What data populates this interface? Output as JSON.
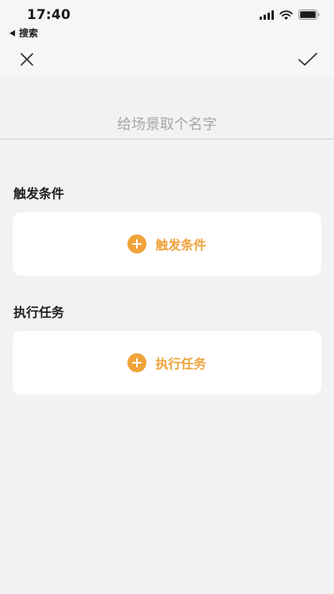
{
  "status_bar": {
    "time": "17:40",
    "back_label": "搜索"
  },
  "nav": {
    "close_icon": "close-icon",
    "confirm_icon": "checkmark-icon"
  },
  "scene_name": {
    "placeholder": "给场景取个名字",
    "value": ""
  },
  "trigger_section": {
    "title": "触发条件",
    "add_label": "触发条件"
  },
  "task_section": {
    "title": "执行任务",
    "add_label": "执行任务"
  },
  "colors": {
    "accent": "#f0a33a",
    "background": "#f2f2f3",
    "card": "#ffffff"
  }
}
